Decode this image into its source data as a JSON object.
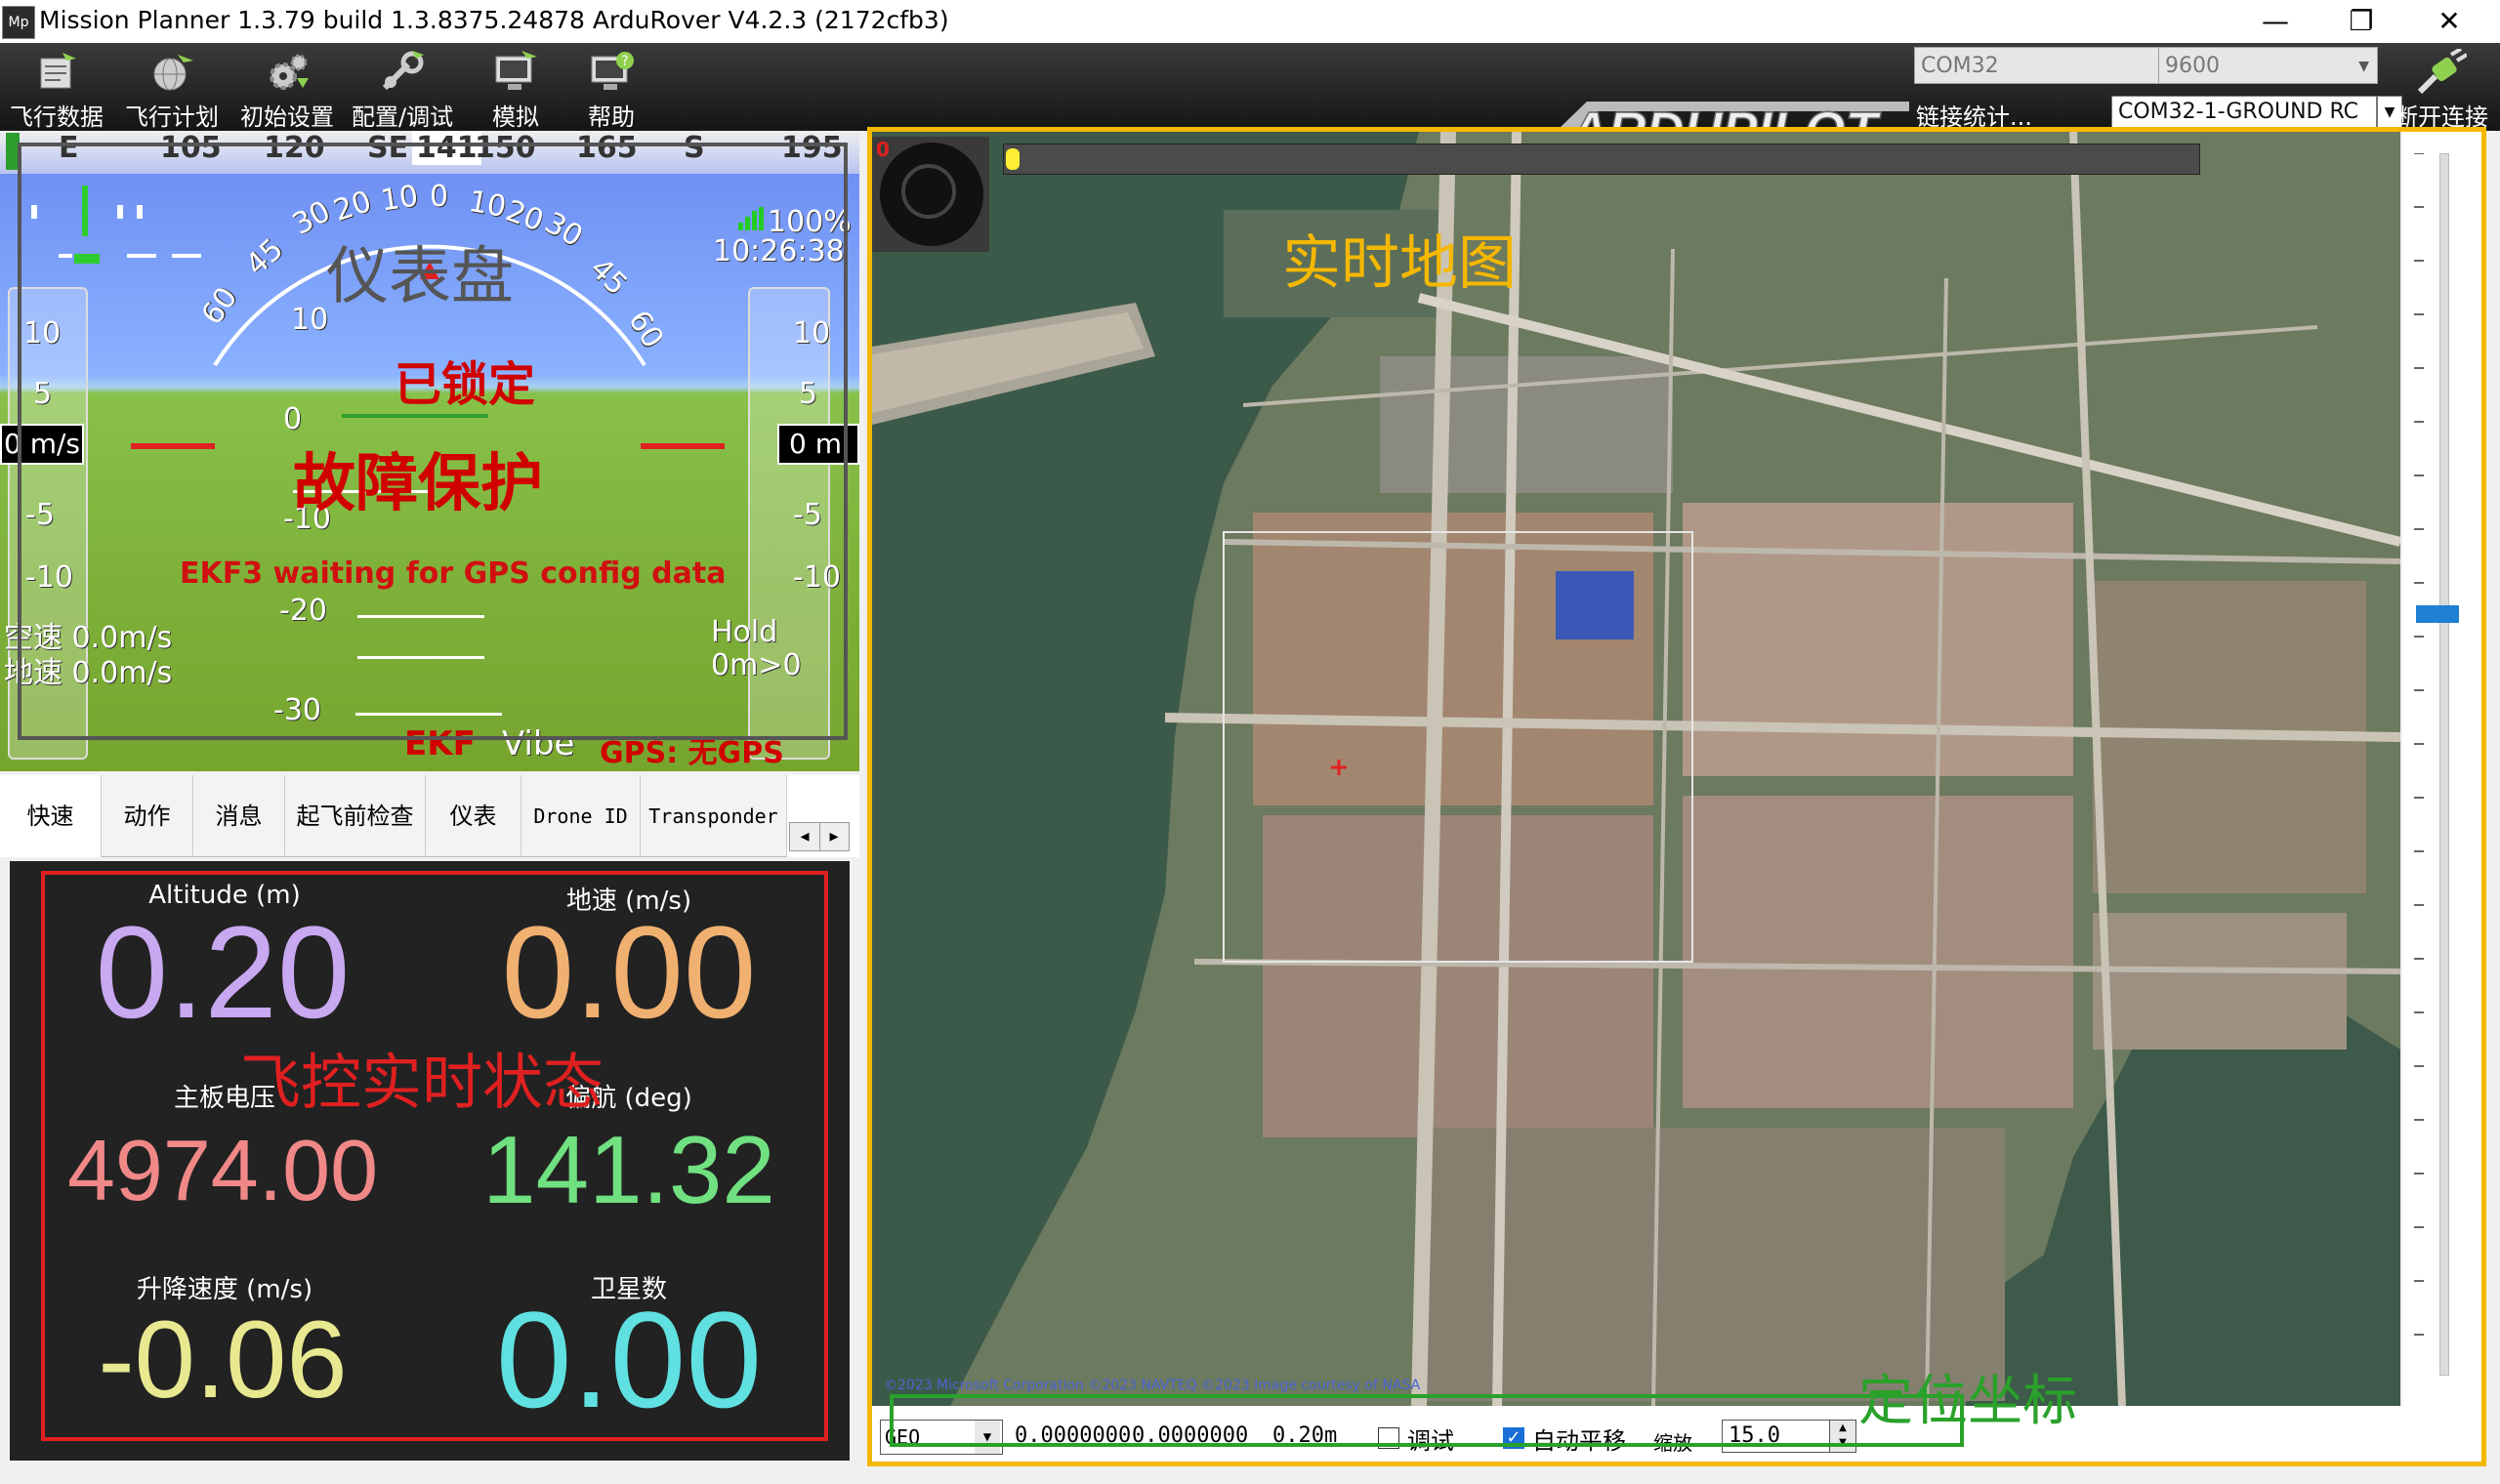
{
  "window": {
    "title": "Mission Planner 1.3.79 build 1.3.8375.24878 ArduRover V4.2.3 (2172cfb3)",
    "app_icon": "Mp",
    "minimize": "—",
    "maximize": "❐",
    "close": "✕"
  },
  "toolbar": {
    "items": [
      {
        "label": "飞行数据",
        "icon": "flight-data-icon"
      },
      {
        "label": "飞行计划",
        "icon": "flight-plan-icon"
      },
      {
        "label": "初始设置",
        "icon": "initial-setup-icon"
      },
      {
        "label": "配置/调试",
        "icon": "config-tuning-icon"
      },
      {
        "label": "模拟",
        "icon": "simulation-icon"
      },
      {
        "label": "帮助",
        "icon": "help-icon"
      }
    ],
    "logo_text": "ARDUPILOT",
    "port": "COM32",
    "baud": "9600",
    "link_stats": "链接统计...",
    "profile": "COM32-1-GROUND RC",
    "disconnect": "断开连接"
  },
  "hud": {
    "heading_ticks": [
      "E",
      "105",
      "120",
      "SE",
      "141",
      "150",
      "165",
      "S",
      "195"
    ],
    "pitch_labels": [
      "10",
      "0",
      "-10",
      "-20",
      "-30"
    ],
    "roll_labels": [
      "60",
      "45",
      "30",
      "20",
      "10",
      "0",
      "10",
      "20",
      "30",
      "45",
      "60"
    ],
    "left_tape": [
      "10",
      "5",
      "-5",
      "-10"
    ],
    "right_tape": [
      "10",
      "5",
      "-5",
      "-10"
    ],
    "speed_box": "0 m/s",
    "alt_box": "0 m",
    "battery_pct": "100%",
    "time": "10:26:38",
    "status_locked": "已锁定",
    "status_failsafe": "故障保护",
    "message": "EKF3 waiting for GPS config data",
    "airspeed": "空速 0.0m/s",
    "groundspeed": "地速 0.0m/s",
    "mode": "Hold",
    "wp": "0m>0",
    "ekf": "EKF",
    "vibe": "Vibe",
    "gps": "GPS: 无GPS",
    "overlay_label": "仪表盘"
  },
  "tabs": {
    "items": [
      "快速",
      "动作",
      "消息",
      "起飞前检查",
      "仪表",
      "Drone ID",
      "Transponder"
    ],
    "scroll_left": "◂",
    "scroll_right": "▸"
  },
  "quick": {
    "items": [
      {
        "label": "Altitude (m)",
        "value": "0.20",
        "color": "#c8a8f0"
      },
      {
        "label": "地速 (m/s)",
        "value": "0.00",
        "color": "#f0b070"
      },
      {
        "label": "主板电压",
        "value": "4974.00",
        "color": "#f08888"
      },
      {
        "label": "偏航 (deg)",
        "value": "141.32",
        "color": "#70e080"
      },
      {
        "label": "升降速度 (m/s)",
        "value": "-0.06",
        "color": "#e8e890"
      },
      {
        "label": "卫星数",
        "value": "0.00",
        "color": "#60e0e0"
      }
    ],
    "overlay_label": "飞控实时状态"
  },
  "map": {
    "overlay_label": "实时地图",
    "position_label": "定位坐标",
    "top_counter": "0",
    "copyright": "©2023 Microsoft Corporation ©2023 NAVTEQ ©2023 Image courtesy of NASA",
    "coord_mode": "GEO",
    "lat": "0.0000000",
    "lon": "0.0000000",
    "dist": "0.20m",
    "debug_label": "调试",
    "debug_checked": false,
    "autopan_label": "自动平移",
    "autopan_checked": true,
    "zoom_label": "缩放",
    "zoom_value": "15.0"
  },
  "colors": {
    "accent_yellow": "#f5b800",
    "annotation_red": "#e02020",
    "annotation_green": "#2aa12a",
    "panel_dark": "#222222"
  }
}
